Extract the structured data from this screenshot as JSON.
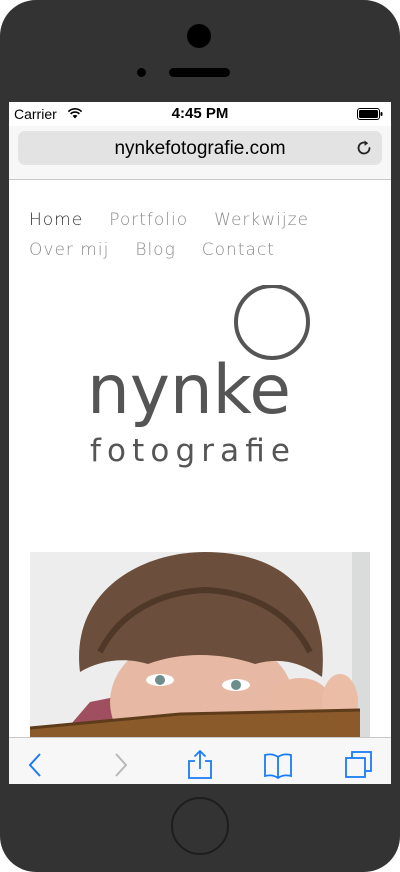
{
  "status_bar": {
    "carrier": "Carrier",
    "time": "4:45 PM"
  },
  "browser": {
    "url": "nynkefotografie.com"
  },
  "nav": {
    "row1": [
      {
        "label": "Home",
        "active": true
      },
      {
        "label": "Portfolio",
        "active": false
      },
      {
        "label": "Werkwijze",
        "active": false
      }
    ],
    "row2": [
      {
        "label": "Over mij",
        "active": false
      },
      {
        "label": "Blog",
        "active": false
      },
      {
        "label": "Contact",
        "active": false
      }
    ]
  },
  "logo": {
    "name": "nynke",
    "tagline": "fotografie"
  },
  "colors": {
    "accent": "#1a7cf5",
    "disabled": "#b8b8b8",
    "logo": "#555555",
    "nav_active": "#333333",
    "nav_inactive": "#8a8a8a",
    "device": "#333333"
  }
}
